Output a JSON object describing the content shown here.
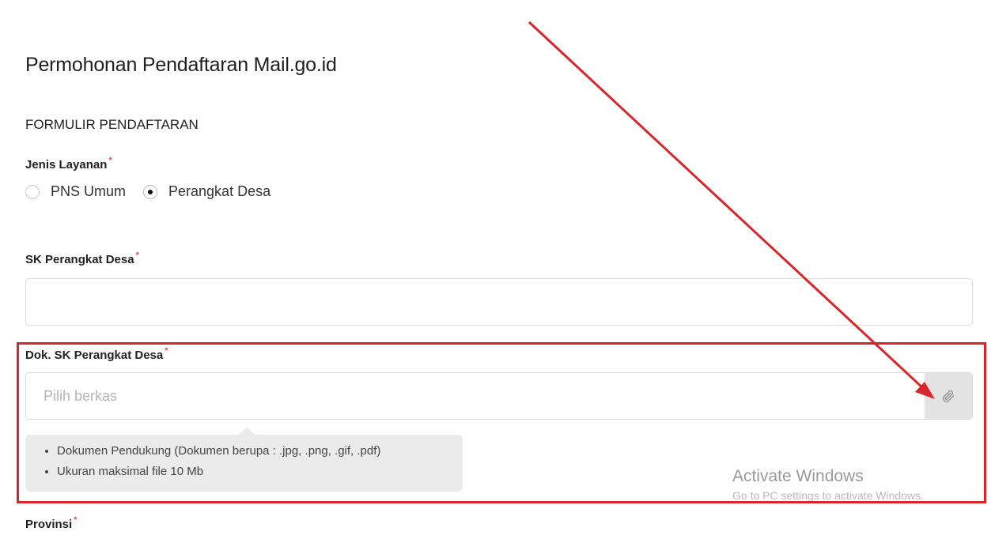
{
  "page": {
    "title": "Permohonan Pendaftaran Mail.go.id",
    "section_title": "FORMULIR PENDAFTARAN"
  },
  "jenis_layanan": {
    "label": "Jenis Layanan",
    "required_mark": "*",
    "options": [
      {
        "label": "PNS Umum",
        "selected": false
      },
      {
        "label": "Perangkat Desa",
        "selected": true
      }
    ]
  },
  "sk_perangkat_desa": {
    "label": "SK Perangkat Desa",
    "required_mark": "*",
    "value": ""
  },
  "dok_sk": {
    "label": "Dok. SK Perangkat Desa",
    "required_mark": "*",
    "placeholder": "Pilih berkas",
    "button_icon": "paperclip-icon",
    "hints": [
      "Dokumen Pendukung (Dokumen berupa : .jpg, .png, .gif, .pdf)",
      "Ukuran maksimal file 10 Mb"
    ]
  },
  "provinsi": {
    "label": "Provinsi",
    "required_mark": "*"
  },
  "watermark": {
    "title": "Activate Windows",
    "subtitle": "Go to PC settings to activate Windows."
  },
  "annotation": {
    "color": "#d9262b"
  }
}
